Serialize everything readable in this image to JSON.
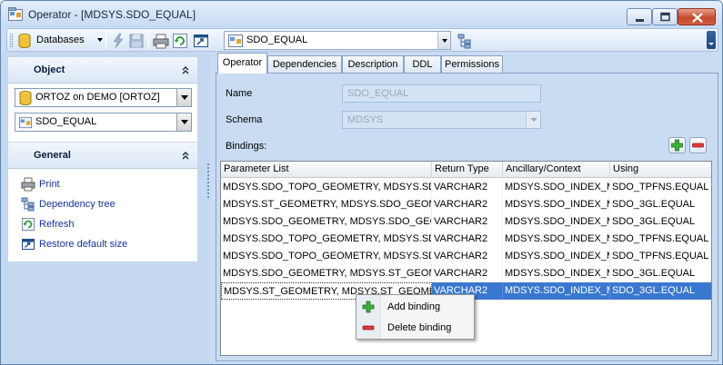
{
  "window": {
    "title": "Operator - [MDSYS.SDO_EQUAL]"
  },
  "toolbar": {
    "databases_label": "Databases",
    "object_combo_value": "SDO_EQUAL"
  },
  "left_panel": {
    "object_header": "Object",
    "database_combo_value": "ORTOZ on DEMO [ORTOZ]",
    "object_combo_value": "SDO_EQUAL",
    "general_header": "General",
    "items": [
      {
        "label": "Print",
        "icon": "printer-icon"
      },
      {
        "label": "Dependency tree",
        "icon": "dependency-tree-icon"
      },
      {
        "label": "Refresh",
        "icon": "refresh-icon"
      },
      {
        "label": "Restore default size",
        "icon": "restore-size-icon"
      }
    ]
  },
  "tabs": [
    {
      "label": "Operator",
      "active": true
    },
    {
      "label": "Dependencies",
      "active": false
    },
    {
      "label": "Description",
      "active": false
    },
    {
      "label": "DDL",
      "active": false
    },
    {
      "label": "Permissions",
      "active": false
    }
  ],
  "form": {
    "name_label": "Name",
    "name_value": "SDO_EQUAL",
    "schema_label": "Schema",
    "schema_value": "MDSYS",
    "bindings_label": "Bindings:"
  },
  "grid": {
    "columns": [
      "Parameter List",
      "Return Type",
      "Ancillary/Context",
      "Using"
    ],
    "rows": [
      [
        "MDSYS.SDO_TOPO_GEOMETRY, MDSYS.SDO_TOPO_GEOMETRY",
        "VARCHAR2",
        "MDSYS.SDO_INDEX_METHOD",
        "SDO_TPFNS.EQUAL"
      ],
      [
        "MDSYS.ST_GEOMETRY, MDSYS.SDO_GEOMETRY",
        "VARCHAR2",
        "MDSYS.SDO_INDEX_METHOD",
        "SDO_3GL.EQUAL"
      ],
      [
        "MDSYS.SDO_GEOMETRY, MDSYS.SDO_GEOMETRY",
        "VARCHAR2",
        "MDSYS.SDO_INDEX_METHOD",
        "SDO_3GL.EQUAL"
      ],
      [
        "MDSYS.SDO_TOPO_GEOMETRY, MDSYS.SDO_TOPO_GEOMETRY",
        "VARCHAR2",
        "MDSYS.SDO_INDEX_METHOD",
        "SDO_TPFNS.EQUAL"
      ],
      [
        "MDSYS.SDO_TOPO_GEOMETRY, MDSYS.SDO_TOPO_GEOMETRY",
        "VARCHAR2",
        "MDSYS.SDO_INDEX_METHOD",
        "SDO_TPFNS.EQUAL"
      ],
      [
        "MDSYS.SDO_GEOMETRY, MDSYS.ST_GEOMETRY",
        "VARCHAR2",
        "MDSYS.SDO_INDEX_METHOD",
        "SDO_3GL.EQUAL"
      ],
      [
        "MDSYS.ST_GEOMETRY, MDSYS.ST_GEOMETRY",
        "VARCHAR2",
        "MDSYS.SDO_INDEX_METHOD",
        "SDO_3GL.EQUAL"
      ]
    ],
    "selected_row": 6
  },
  "context_menu": {
    "items": [
      {
        "label": "Add binding",
        "icon": "add-icon"
      },
      {
        "label": "Delete binding",
        "icon": "delete-icon"
      }
    ]
  },
  "colors": {
    "selection": "#3a78d0",
    "frame": "#c9dcf2",
    "link": "#15329c"
  }
}
